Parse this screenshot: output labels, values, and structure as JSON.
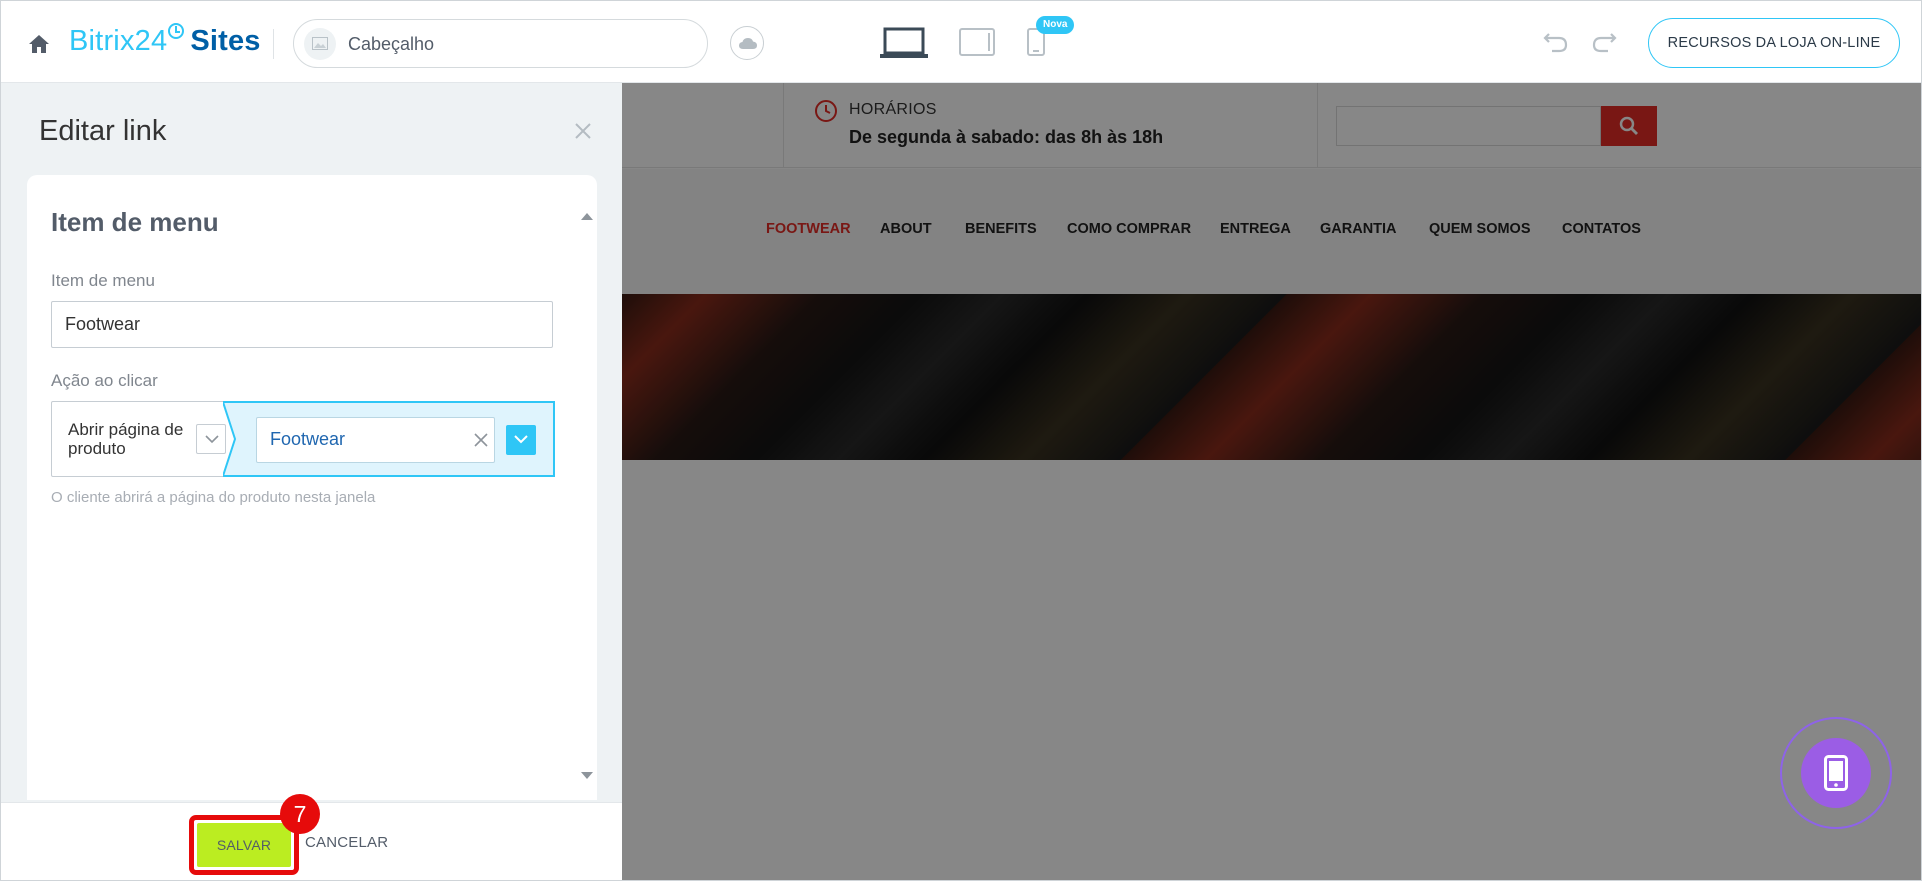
{
  "topbar": {
    "brand_part1": "Bitrix24",
    "brand_part2": "Sites",
    "block_label": "Cabeçalho",
    "new_badge": "Nova",
    "store_button": "RECURSOS DA LOJA ON-LINE",
    "accent_color": "#2fc6f6"
  },
  "preview": {
    "hours_title": "HORÁRIOS",
    "hours_value": "De segunda à sabado: das 8h às 18h",
    "menu": [
      "FOOTWEAR",
      "ABOUT",
      "BENEFITS",
      "COMO COMPRAR",
      "ENTREGA",
      "GARANTIA",
      "QUEM SOMOS",
      "CONTATOS"
    ],
    "active_menu": "FOOTWEAR",
    "search_color": "#e52d27"
  },
  "panel": {
    "title": "Editar link",
    "card_title": "Item de menu",
    "menu_item_label": "Item de menu",
    "menu_item_value": "Footwear",
    "action_label": "Ação ao clicar",
    "action_type": "Abrir página de produto",
    "action_target": "Footwear",
    "hint": "O cliente abrirá a página do produto nesta janela",
    "save_label": "SALVAR",
    "cancel_label": "CANCELAR",
    "step_number": "7",
    "save_color": "#bbed21",
    "highlight_color": "#e60b0b"
  },
  "icons": [
    "home-icon",
    "cloud-icon",
    "desktop-icon",
    "tablet-icon",
    "mobile-icon",
    "undo-icon",
    "redo-icon",
    "close-icon",
    "clock-icon",
    "search-icon",
    "chevron-down-icon",
    "clear-icon",
    "phone-icon"
  ]
}
